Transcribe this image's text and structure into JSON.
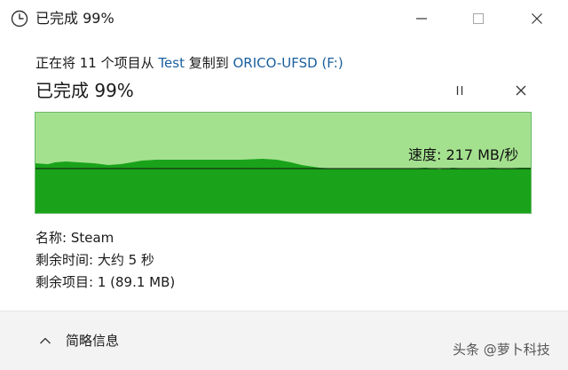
{
  "window": {
    "title": "已完成 99%",
    "icon": "clock-icon",
    "controls": [
      "minimize-icon",
      "maximize-icon",
      "close-icon"
    ]
  },
  "transfer": {
    "prefix": "正在将 11 个项目从 ",
    "source": "Test",
    "middle": " 复制到 ",
    "destination": "ORICO-UFSD (F:)"
  },
  "status": {
    "heading": "已完成 99%",
    "pause_icon": "pause-icon",
    "cancel_icon": "close-icon"
  },
  "graph": {
    "speed_text": "速度: 217 MB/秒",
    "progress_percent": 99,
    "colors": {
      "completed": "#a4e18f",
      "speed_fill": "#1aa31a",
      "border": "#6ab86a"
    }
  },
  "details": {
    "name_label": "名称:",
    "name_value": "Steam",
    "time_label": "剩余时间:",
    "time_value": "大约 5 秒",
    "items_label": "剩余项目:",
    "items_value": "1 (89.1 MB)"
  },
  "footer": {
    "toggle_label": "简略信息",
    "toggle_icon": "chevron-up-icon",
    "watermark": "头条 @萝卜科技"
  }
}
